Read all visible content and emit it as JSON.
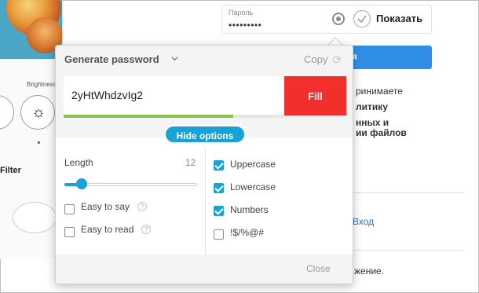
{
  "login_form": {
    "password_label": "Пароль",
    "password_value": "•••••••••",
    "show_label": "Показать",
    "login_button": "я",
    "text_lines": [
      "ринимаете",
      "литику",
      "нных и",
      "ии файлов"
    ],
    "link_text": "Вход",
    "footer_text": "жение."
  },
  "phone": {
    "brightness_label": "Brightness",
    "filter_label": "Filter"
  },
  "popup": {
    "title": "Generate password",
    "copy_label": "Copy",
    "generated_password": "2yHtWhdzvIg2",
    "strength_fraction": 0.77,
    "fill_label": "Fill",
    "hide_options_label": "Hide options",
    "length_label": "Length",
    "length_value": "12",
    "length_slider_fraction": 0.13,
    "options_left": [
      {
        "label": "Easy to say",
        "checked": false,
        "help": "?"
      },
      {
        "label": "Easy to read",
        "checked": false,
        "help": "?"
      }
    ],
    "options_right": [
      {
        "label": "Uppercase",
        "checked": true
      },
      {
        "label": "Lowercase",
        "checked": true
      },
      {
        "label": "Numbers",
        "checked": true
      },
      {
        "label": "!$/%@#",
        "checked": false
      }
    ],
    "close_label": "Close"
  },
  "colors": {
    "accent": "#19a2d6",
    "fill_button": "#f1302d",
    "strength": "#8bc34a",
    "login_button": "#2f8fe6"
  }
}
